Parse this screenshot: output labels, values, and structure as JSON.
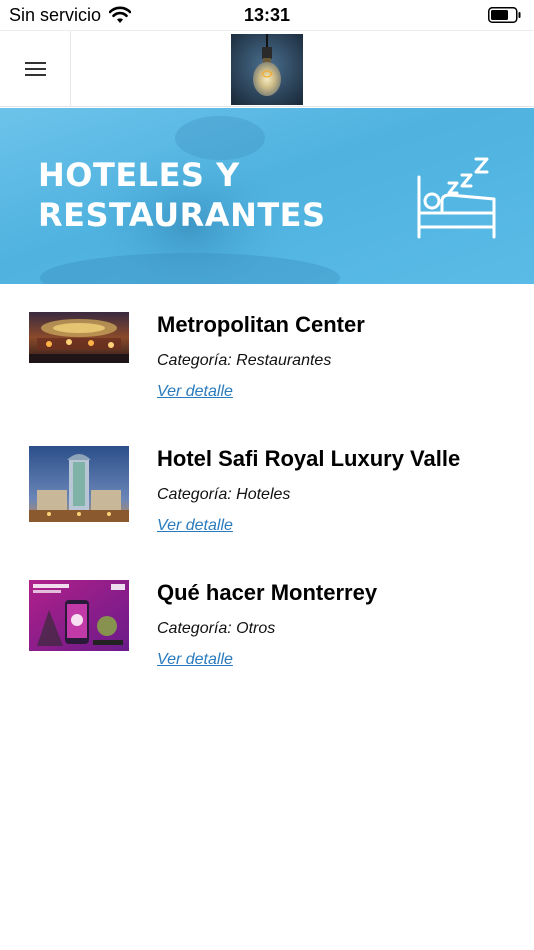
{
  "status_bar": {
    "carrier": "Sin servicio",
    "time": "13:31"
  },
  "header": {
    "menu_icon": "hamburger-icon",
    "logo_icon": "light-bulb-logo"
  },
  "banner": {
    "title": "HOTELES Y\nRESTAURANTES",
    "icon": "sleeping-bed-icon",
    "color": "#4fb2df"
  },
  "items": [
    {
      "title": "Metropolitan Center",
      "category": "Categoría: Restaurantes",
      "link": "Ver detalle"
    },
    {
      "title": "Hotel Safi Royal Luxury Valle",
      "category": "Categoría: Hoteles",
      "link": "Ver detalle"
    },
    {
      "title": "Qué hacer Monterrey",
      "category": "Categoría: Otros",
      "link": "Ver detalle"
    }
  ],
  "colors": {
    "link": "#2a7bbd",
    "banner": "#4fb2df"
  }
}
